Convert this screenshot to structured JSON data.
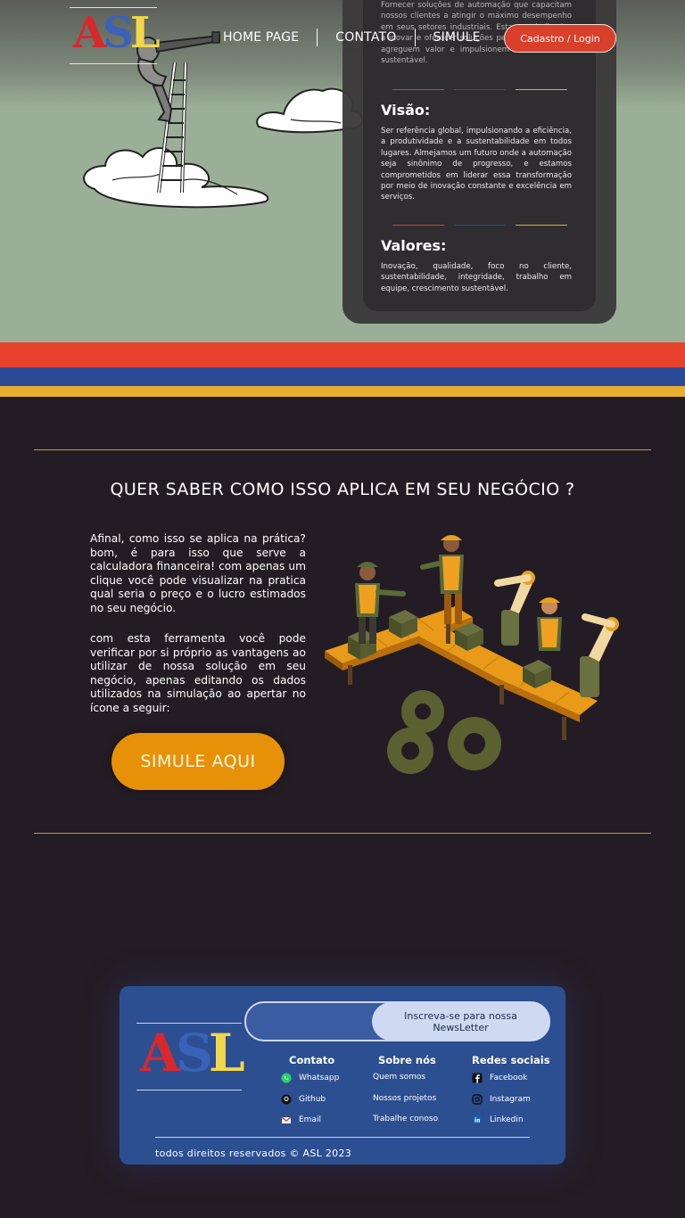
{
  "header": {
    "logo": {
      "letters": [
        "A",
        "S",
        "L"
      ]
    },
    "nav": [
      {
        "label": "HOME PAGE"
      },
      {
        "label": "CONTATO"
      },
      {
        "label": "SIMULE"
      }
    ],
    "login_label": "Cadastro  /  Login"
  },
  "about": {
    "mission_text": "Fornecer soluções de automação que capacitam nossos clientes a atingir o máximo desempenho em seus setores industriais. Estamos dedicados a inovar e oferecer soluções personalizadas que agreguem valor e impulsionem o crescimento sustentável.",
    "vision_title": "Visão:",
    "vision_text": "Ser referência global, impulsionando a eficiência, a produtividade e a sustentabilidade em todos lugares. Almejamos um futuro onde a automação seja sinônimo de progresso, e estamos comprometidos em liderar essa transformação por meio de inovação constante e excelência em serviços.",
    "values_title": "Valores:",
    "values_text": "Inovação, qualidade, foco no cliente, sustentabilidade, integridade, trabalho em equipe, crescimento sustentável."
  },
  "colors": {
    "red": "#e8412d",
    "blue": "#2b4a96",
    "yellow": "#e9ad32",
    "orange_cta": "#e69107",
    "footer_bg": "#2c4f92",
    "page_bg": "#241c24"
  },
  "simulate": {
    "title": "QUER SABER COMO ISSO APLICA EM SEU NEGÓCIO ?",
    "paragraph1": "Afinal, como isso se aplica na prática? bom, é para isso que serve a calculadora financeira! com apenas um clique você pode visualizar na pratica qual seria o preço e o lucro estimados no seu negócio.",
    "paragraph2": "com esta ferramenta você pode verificar por si próprio as vantagens ao utilizar de nossa solução em seu negócio, apenas editando os dados utilizados na simulação ao apertar no ícone a seguir:",
    "cta_label": "SIMULE AQUI"
  },
  "footer": {
    "newsletter_label": "Inscreva-se para nossa NewsLetter",
    "contact": {
      "title": "Contato",
      "items": [
        {
          "label": "Whatsapp",
          "icon": "whatsapp-icon"
        },
        {
          "label": "Github",
          "icon": "github-icon"
        },
        {
          "label": "Email",
          "icon": "email-icon"
        }
      ]
    },
    "about": {
      "title": "Sobre nós",
      "items": [
        {
          "label": "Quem somos"
        },
        {
          "label": "Nossos projetos"
        },
        {
          "label": "Trabalhe conoso"
        }
      ]
    },
    "social": {
      "title": "Redes sociais",
      "items": [
        {
          "label": "Facebook",
          "icon": "facebook-icon"
        },
        {
          "label": "Instagram",
          "icon": "instagram-icon"
        },
        {
          "label": "Linkedin",
          "icon": "linkedin-icon"
        }
      ]
    },
    "copyright": "todos direitos reservados © ASL 2023"
  }
}
